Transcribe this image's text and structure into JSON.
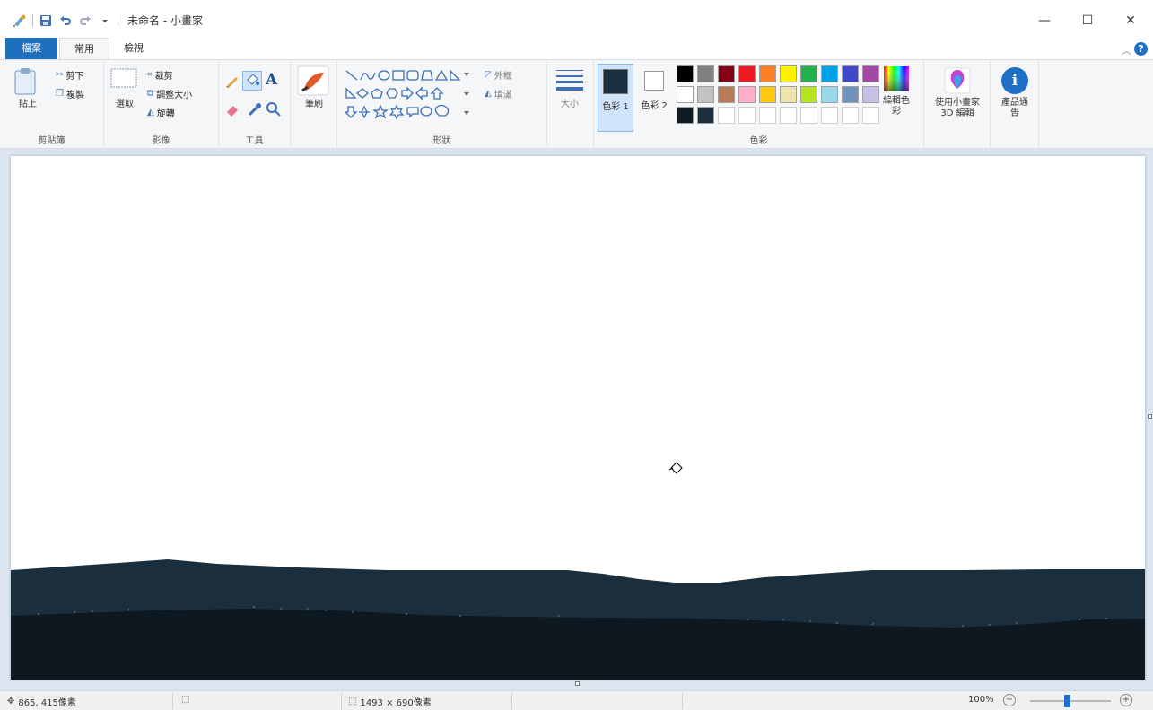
{
  "window": {
    "title": "未命名 - 小畫家",
    "minimize_glyph": "—",
    "maximize_glyph": "☐",
    "close_glyph": "✕"
  },
  "tabs": {
    "file": "檔案",
    "home": "常用",
    "view": "檢視"
  },
  "ribbon": {
    "clipboard": {
      "paste": "貼上",
      "cut": "剪下",
      "copy": "複製",
      "group": "剪貼簿"
    },
    "image": {
      "select": "選取",
      "crop": "裁剪",
      "resize": "調整大小",
      "rotate": "旋轉",
      "group": "影像"
    },
    "tools": {
      "group": "工具"
    },
    "brushes": {
      "label": "筆刷"
    },
    "shapes": {
      "outline": "外框",
      "fill": "填滿",
      "group": "形狀"
    },
    "size": {
      "label": "大小"
    },
    "colors": {
      "color1": "色彩 1",
      "color2": "色彩 2",
      "edit_colors": "編輯色彩",
      "group": "色彩",
      "color1_value": "#1b2e3d",
      "color2_value": "#ffffff",
      "palette_row1": [
        "#000000",
        "#7f7f7f",
        "#880015",
        "#ed1c24",
        "#ff7f27",
        "#fff200",
        "#22b14c",
        "#00a2e8",
        "#3f48cc",
        "#a349a4"
      ],
      "palette_row2": [
        "#ffffff",
        "#c3c3c3",
        "#b97a57",
        "#ffaec9",
        "#ffc90e",
        "#efe4b0",
        "#b5e61d",
        "#99d9ea",
        "#7092be",
        "#c8bfe7"
      ],
      "palette_row3": [
        "#0d1b24",
        "#1b2e3d",
        "",
        "",
        "",
        "",
        "",
        "",
        "",
        ""
      ]
    },
    "paint3d": {
      "label": "使用小畫家 3D 編輯"
    },
    "product_alert": {
      "label": "產品通告"
    }
  },
  "canvas": {
    "sky_color": "#ffffff",
    "mid_color": "#1b2e3d",
    "ground_color": "#0d1820"
  },
  "status": {
    "cursor_pos": "865, 415像素",
    "canvas_size": "1493 × 690像素",
    "zoom": "100%"
  }
}
